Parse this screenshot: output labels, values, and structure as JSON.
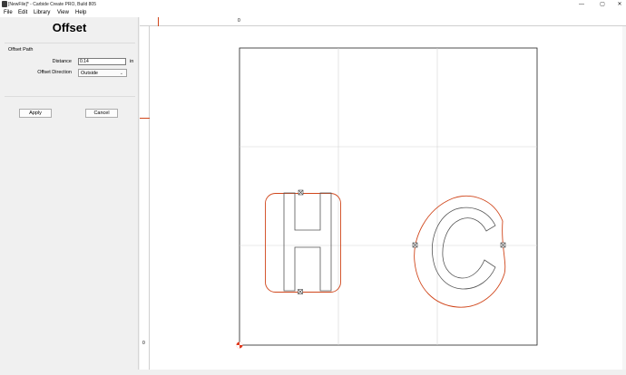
{
  "window": {
    "title": "[NewFile]* - Carbide Create PRO, Build 805",
    "controls": {
      "minimize": "—",
      "maximize": "▢",
      "close": "✕"
    }
  },
  "menu": {
    "file": "File",
    "edit": "Edit",
    "library": "Library",
    "view": "View",
    "help": "Help"
  },
  "panel": {
    "title": "Offset",
    "section_label": "Offset Path",
    "distance_label": "Distance",
    "distance_value": "0.14",
    "distance_unit": "in",
    "direction_label": "Offset Direction",
    "direction_value": "Outside",
    "apply_label": "Apply",
    "cancel_label": "Cancel"
  },
  "rulers": {
    "top_zero": "0",
    "left_zero": "0"
  },
  "colors": {
    "accent": "#d0461b",
    "path": "#555555",
    "grid": "#d4d4d4"
  },
  "canvas": {
    "selected_letters": [
      "H",
      "C"
    ]
  }
}
